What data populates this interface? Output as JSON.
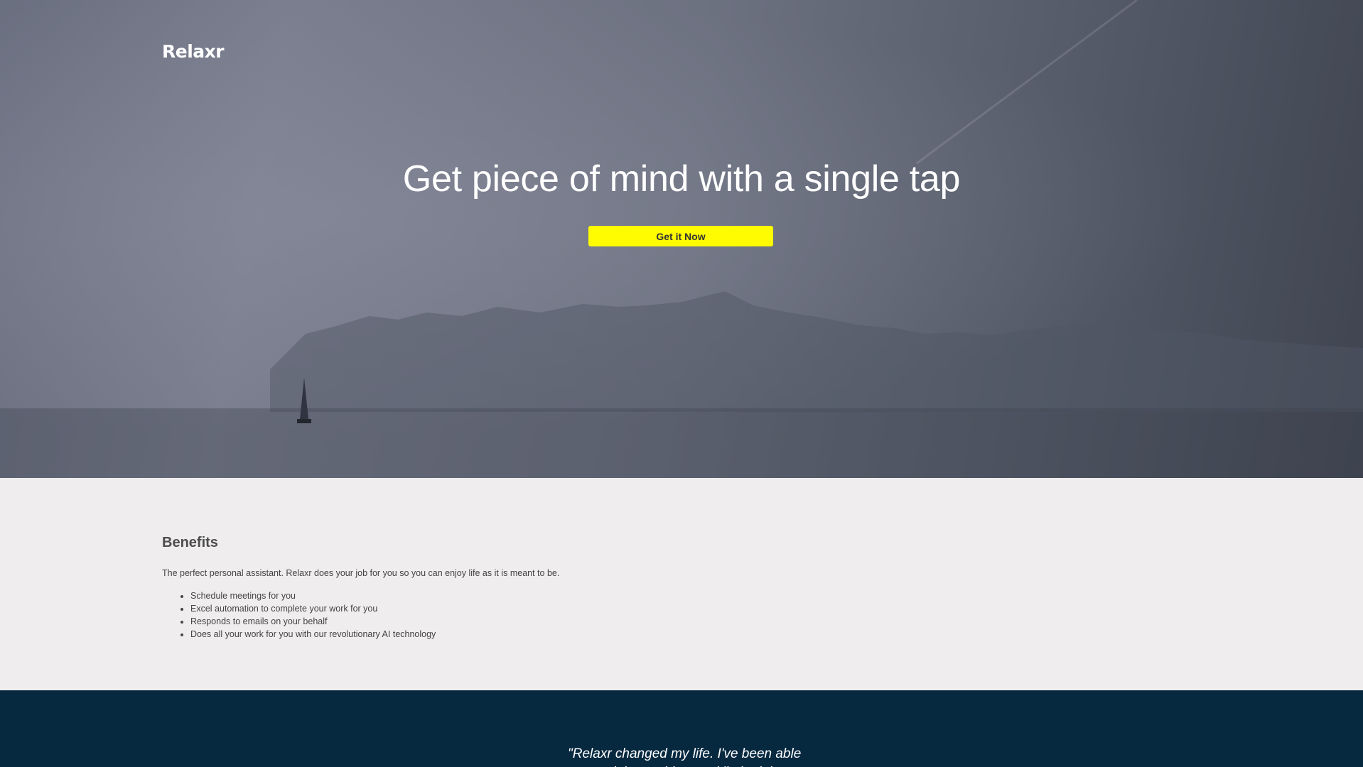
{
  "brand": {
    "name": "Relaxr"
  },
  "hero": {
    "headline": "Get piece of mind with a single tap",
    "cta_label": "Get it Now",
    "cta_color": "#fffb00"
  },
  "benefits": {
    "heading": "Benefits",
    "description": "The perfect personal assistant. Relaxr does your job for you so you can enjoy life as it is meant to be.",
    "items": [
      "Schedule meetings for you",
      "Excel automation to complete your work for you",
      "Responds to emails on your behalf",
      "Does all your work for you with our revolutionary AI technology"
    ]
  },
  "testimonial": {
    "quote": "\"Relaxr changed my life. I've been able to travel the world, spend limited time at work and relax"
  },
  "colors": {
    "benefits_bg": "#efedee",
    "testimonial_bg": "#072940"
  }
}
